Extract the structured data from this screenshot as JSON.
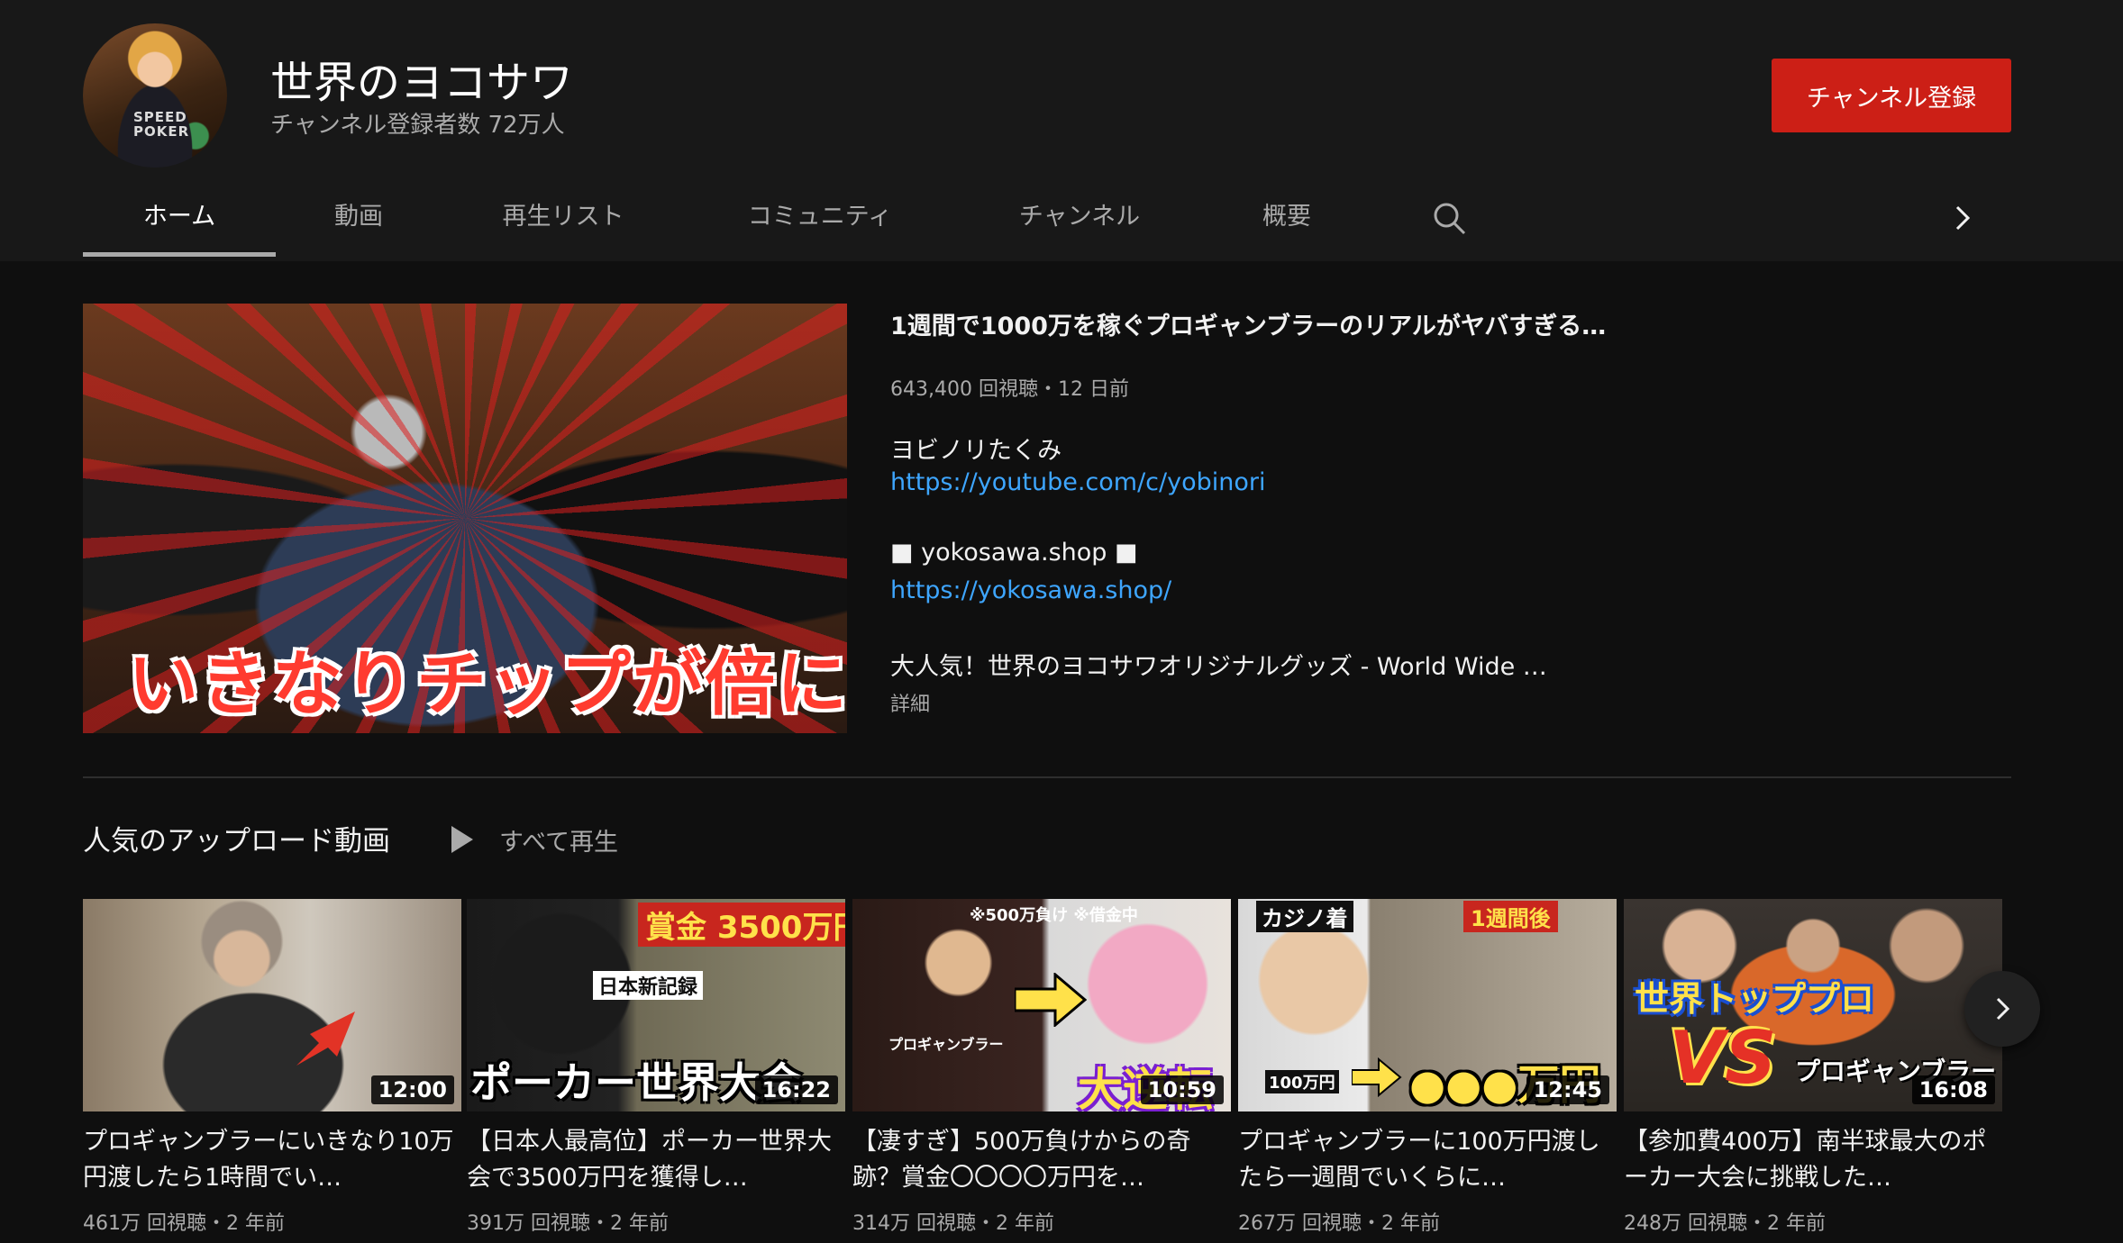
{
  "channel": {
    "name": "世界のヨコサワ",
    "subscribers": "チャンネル登録者数 72万人",
    "subscribe_label": "チャンネル登録",
    "avatar_text": "SPEED\nPOKER"
  },
  "tabs": [
    {
      "label": "ホーム",
      "active": true
    },
    {
      "label": "動画"
    },
    {
      "label": "再生リスト"
    },
    {
      "label": "コミュニティ"
    },
    {
      "label": "チャンネル"
    },
    {
      "label": "概要"
    }
  ],
  "featured": {
    "title": "1週間で1000万を稼ぐプロギャンブラーのリアルがヤバすぎる…",
    "meta": "643,400 回視聴・12 日前",
    "thumbnail_caption": "いきなりチップが倍に！",
    "desc_line1": "ヨビノリたくみ",
    "link1": "https://youtube.com/c/yobinori",
    "desc_line2": "■ yokosawa.shop ■",
    "link2": "https://yokosawa.shop/",
    "desc_line3": "大人気！世界のヨコサワオリジナルグッズ - World Wide …",
    "more_label": "詳細"
  },
  "shelf": {
    "title": "人気のアップロード動画",
    "play_all_label": "すべて再生",
    "videos": [
      {
        "title": "プロギャンブラーにいきなり10万円渡したら1時間でい…",
        "meta": "461万 回視聴・2 年前",
        "duration": "12:00",
        "thumb_text": ""
      },
      {
        "title": "【日本人最高位】ポーカー世界大会で3500万円を獲得し…",
        "meta": "391万 回視聴・2 年前",
        "duration": "16:22",
        "thumb_text": "ポーカー世界大会",
        "thumb_text2": "賞金 3500万円",
        "thumb_text3": "日本新記録"
      },
      {
        "title": "【凄すぎ】500万負けからの奇跡？賞金〇〇〇〇万円を…",
        "meta": "314万 回視聴・2 年前",
        "duration": "10:59",
        "thumb_text": "大逆転",
        "thumb_text2": "※500万負け ※借金中",
        "thumb_text3": "プロギャンブラー"
      },
      {
        "title": "プロギャンブラーに100万円渡したら一週間でいくらに…",
        "meta": "267万 回視聴・2 年前",
        "duration": "12:45",
        "thumb_text": "●●●万円",
        "thumb_text2": "カジノ着",
        "thumb_text3": "1週間後",
        "thumb_text4": "100万円"
      },
      {
        "title": "【参加費400万】南半球最大のポーカー大会に挑戦した…",
        "meta": "248万 回視聴・2 年前",
        "duration": "16:08",
        "thumb_text": "VS",
        "thumb_text2": "世界トッププロ",
        "thumb_text3": "プロギャンブラー"
      }
    ]
  },
  "colors": {
    "accent": "#cc1f16",
    "link": "#3ea6ff",
    "background": "#0f0f0f",
    "header": "#181818"
  }
}
